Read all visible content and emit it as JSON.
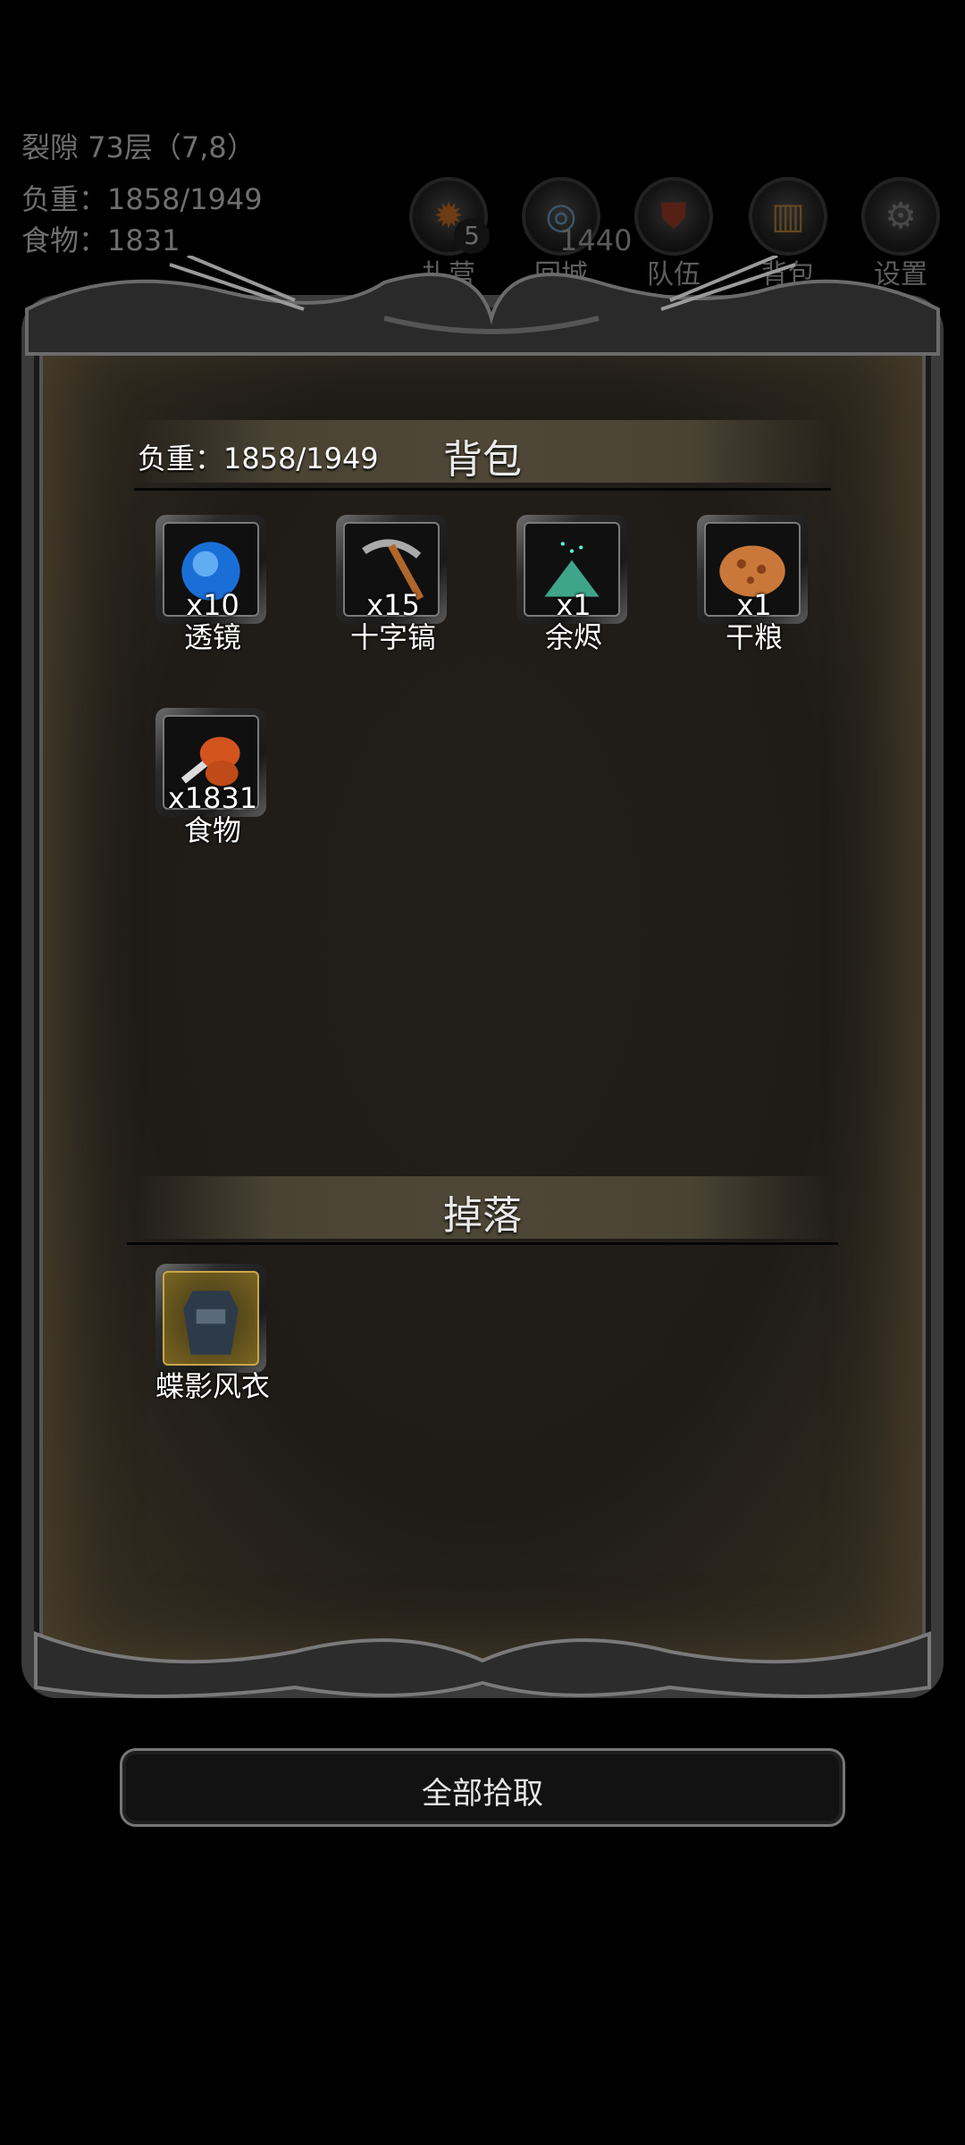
{
  "hud": {
    "floor": "裂隙 73层（7,8）",
    "weight": "负重：1858/1949",
    "food": "食物：1831",
    "gold": "1440"
  },
  "top_buttons": [
    {
      "label": "扎营",
      "icon": "campfire-icon",
      "badge": "5"
    },
    {
      "label": "回城",
      "icon": "portal-icon"
    },
    {
      "label": "队伍",
      "icon": "shield-icon"
    },
    {
      "label": "背包",
      "icon": "barrel-icon"
    },
    {
      "label": "设置",
      "icon": "gear-icon"
    }
  ],
  "bag": {
    "title": "背包",
    "weight": "负重：1858/1949",
    "items": [
      {
        "name": "透镜",
        "count": "x10",
        "icon": "lens-icon"
      },
      {
        "name": "十字镐",
        "count": "x15",
        "icon": "pickaxe-icon"
      },
      {
        "name": "余烬",
        "count": "x1",
        "icon": "ember-icon"
      },
      {
        "name": "干粮",
        "count": "x1",
        "icon": "ration-icon"
      },
      {
        "name": "食物",
        "count": "x1831",
        "icon": "meat-icon"
      }
    ]
  },
  "drops": {
    "title": "掉落",
    "items": [
      {
        "name": "蝶影风衣",
        "icon": "coat-icon"
      }
    ]
  },
  "pickup_all_label": "全部拾取"
}
